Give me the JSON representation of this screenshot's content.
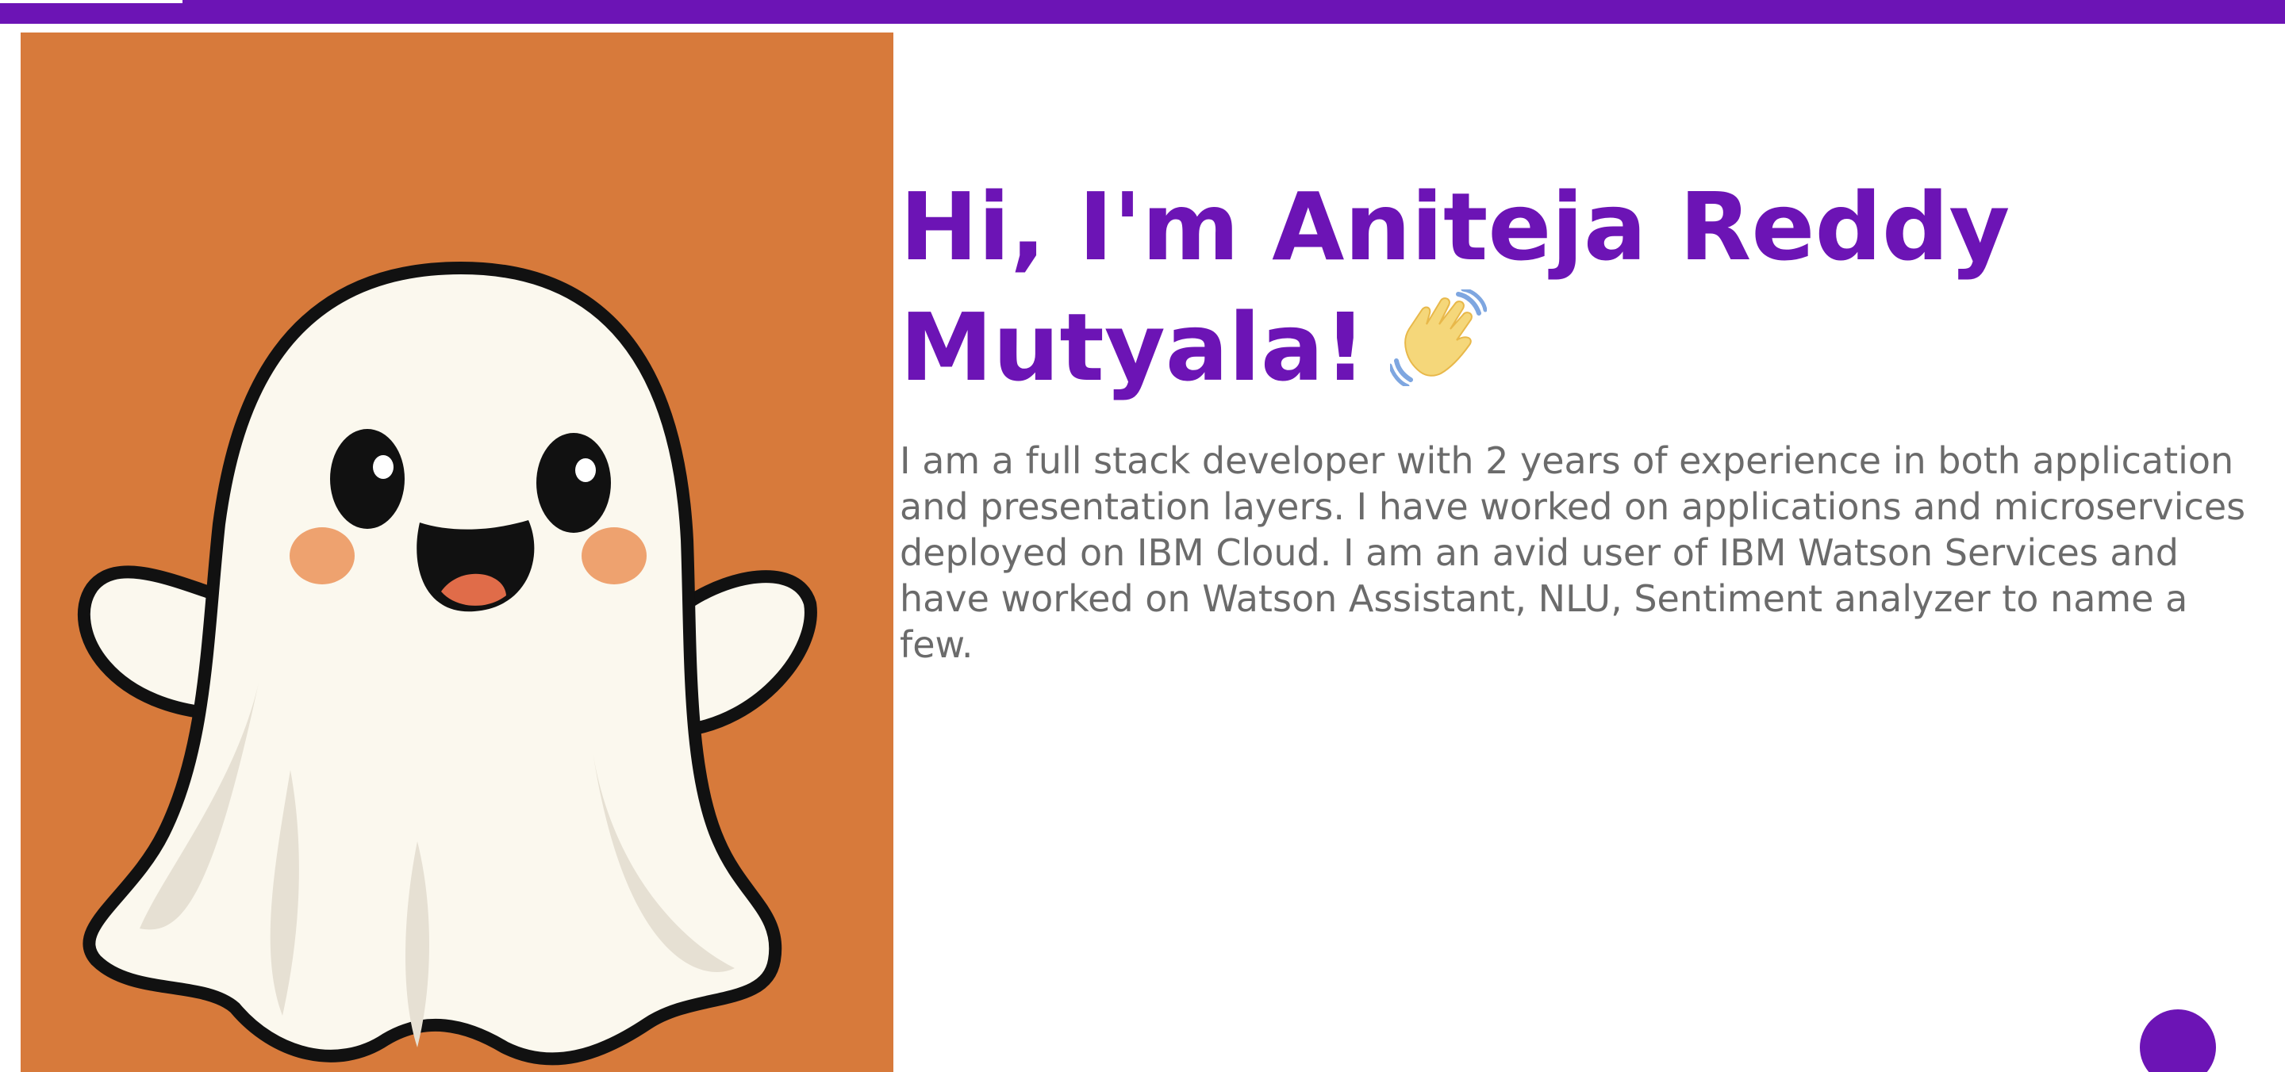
{
  "colors": {
    "accent": "#6c14b5",
    "image_background": "#d77a3b",
    "body_text": "#6b6b6b"
  },
  "progress": {
    "fraction": 0.08
  },
  "hero": {
    "image_icon": "ghost-illustration",
    "title": "Hi, I'm Aniteja Reddy Mutyala!",
    "title_icon": "waving-hand-icon",
    "bio": "I am a full stack developer with 2 years of experience in both application and presentation layers. I have worked on applications and microservices deployed on IBM Cloud. I am an avid user of IBM Watson Services and have worked on Watson Assistant, NLU, Sentiment analyzer to name a few."
  },
  "fab": {
    "icon": "circle-button"
  }
}
